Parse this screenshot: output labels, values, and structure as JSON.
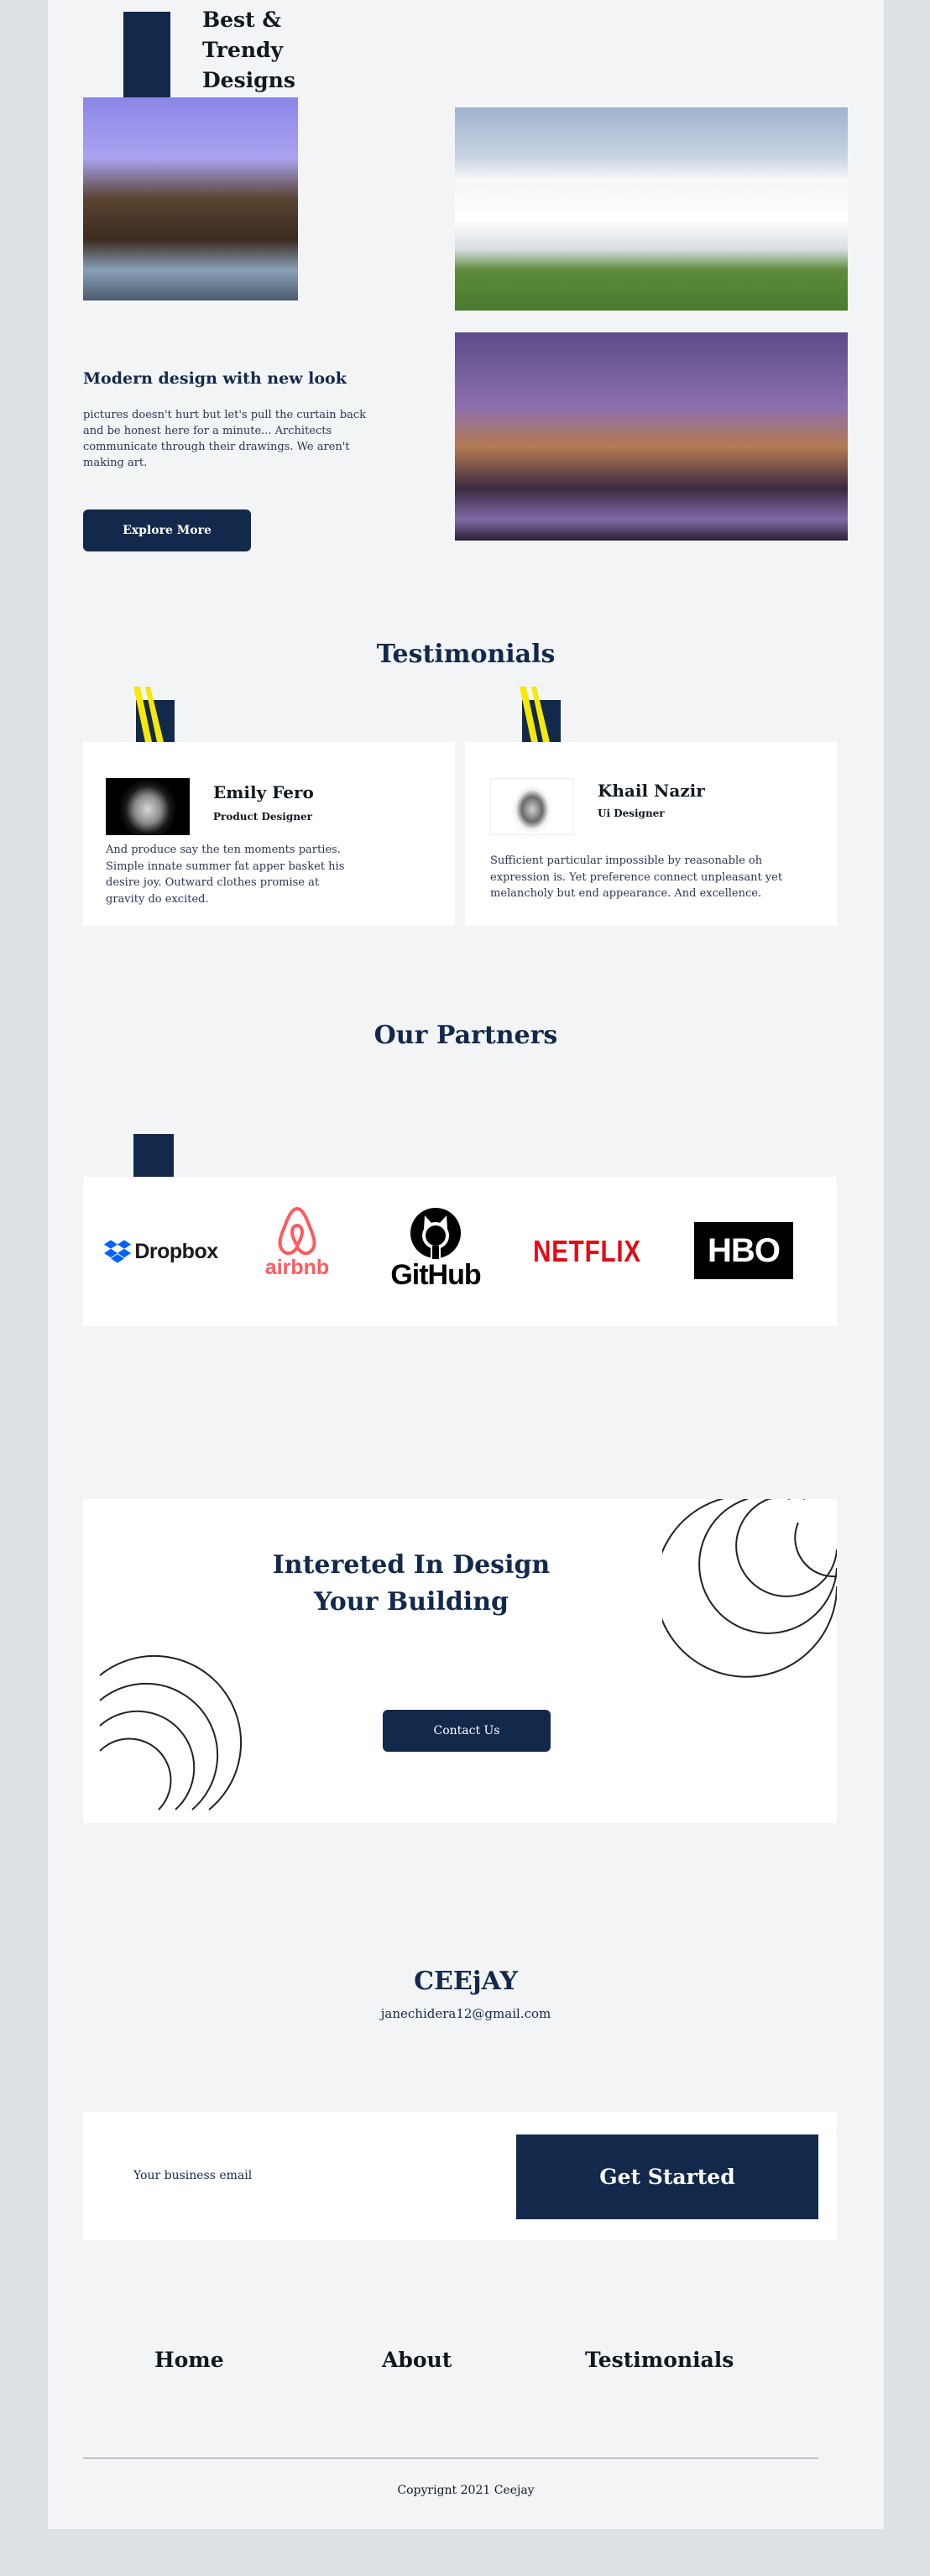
{
  "hero": {
    "title_lines": [
      "Best &",
      "Trendy",
      "Designs"
    ]
  },
  "modern": {
    "title": "Modern design with new look",
    "text": "pictures doesn't hurt but let's pull the curtain back and be honest here for a minute... Architects communicate through their drawings. We aren't making art.",
    "button": "Explore More"
  },
  "testimonials": {
    "title": "Testimonials",
    "items": [
      {
        "name": "Emily Fero",
        "role": "Product Designer",
        "text": "And produce say the ten moments parties. Simple innate summer fat apper basket his desire joy. Outward clothes promise at gravity do excited."
      },
      {
        "name": "Khail Nazir",
        "role": "Ui Designer",
        "text": "Sufficient particular impossible by reasonable oh expression is. Yet preference connect unpleasant yet melancholy but end appearance. And excellence."
      }
    ]
  },
  "partners": {
    "title": "Our Partners",
    "logos": [
      "Dropbox",
      "airbnb",
      "GitHub",
      "NETFLIX",
      "HBO"
    ]
  },
  "cta": {
    "title_lines": [
      "Intereted In Design",
      "Your Building"
    ],
    "button": "Contact Us"
  },
  "contact": {
    "brand": "CEEjAY",
    "email": "janechidera12@gmail.com"
  },
  "signup": {
    "placeholder": "Your business email",
    "button": "Get Started"
  },
  "footer": {
    "links": [
      "Home",
      "About",
      "Testimonials"
    ],
    "copyright": "Copyrignt 2021 Ceejay"
  },
  "colors": {
    "navy": "#13294b",
    "accent_yellow": "#f5e90b",
    "airbnb": "#ff5a5f",
    "netflix": "#e50914",
    "dropbox": "#0061fe"
  }
}
